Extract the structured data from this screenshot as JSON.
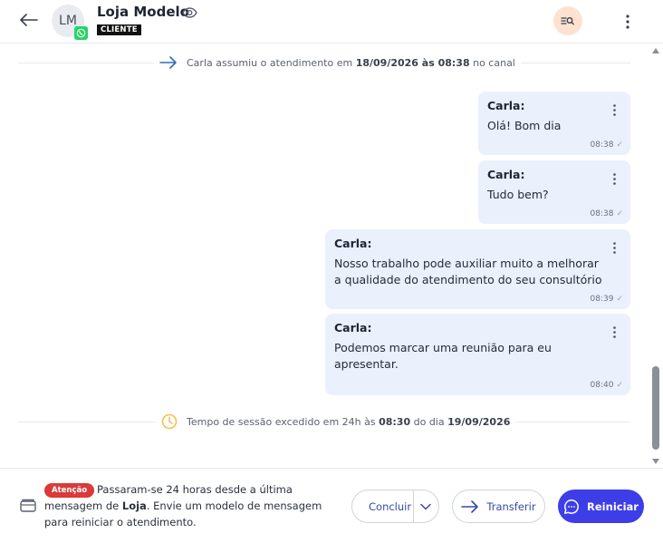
{
  "header": {
    "avatar_initials": "LM",
    "contact_name": "Loja Modelo",
    "role_tag": "CLIENTE",
    "channel_icon": "whatsapp-icon",
    "search_button_color": "#fde2cf"
  },
  "events": {
    "assumed": {
      "prefix": "Carla assumiu o atendimento em",
      "datetime": "18/09/2026 às 08:38",
      "suffix": "no canal"
    },
    "timeout": {
      "prefix": "Tempo de sessão excedido em 24h às",
      "time": "08:30",
      "middle": "do dia",
      "date": "19/09/2026"
    }
  },
  "messages": [
    {
      "sender": "Carla:",
      "text": "Olá! Bom dia",
      "time": "08:38"
    },
    {
      "sender": "Carla:",
      "text": "Tudo bem?",
      "time": "08:38"
    },
    {
      "sender": "Carla:",
      "text": "Nosso trabalho pode auxiliar muito a melhorar a qualidade do atendimento do seu consultório",
      "time": "08:39"
    },
    {
      "sender": "Carla:",
      "text": "Podemos marcar uma reunião para eu apresentar.",
      "time": "08:40"
    }
  ],
  "footer": {
    "attention_badge": "Atenção",
    "warning_part1": "Passaram-se 24 horas desde a última mensagem de",
    "warning_bold": "Loja",
    "warning_part2": ". Envie um modelo de mensagem para reiniciar o atendimento.",
    "concluir_label": "Concluir",
    "transferir_label": "Transferir",
    "reiniciar_label": "Reiniciar"
  },
  "colors": {
    "bubble_bg": "#eaf0fc",
    "primary": "#3d3ee8",
    "attention": "#d93a3a",
    "whatsapp": "#25d366"
  }
}
